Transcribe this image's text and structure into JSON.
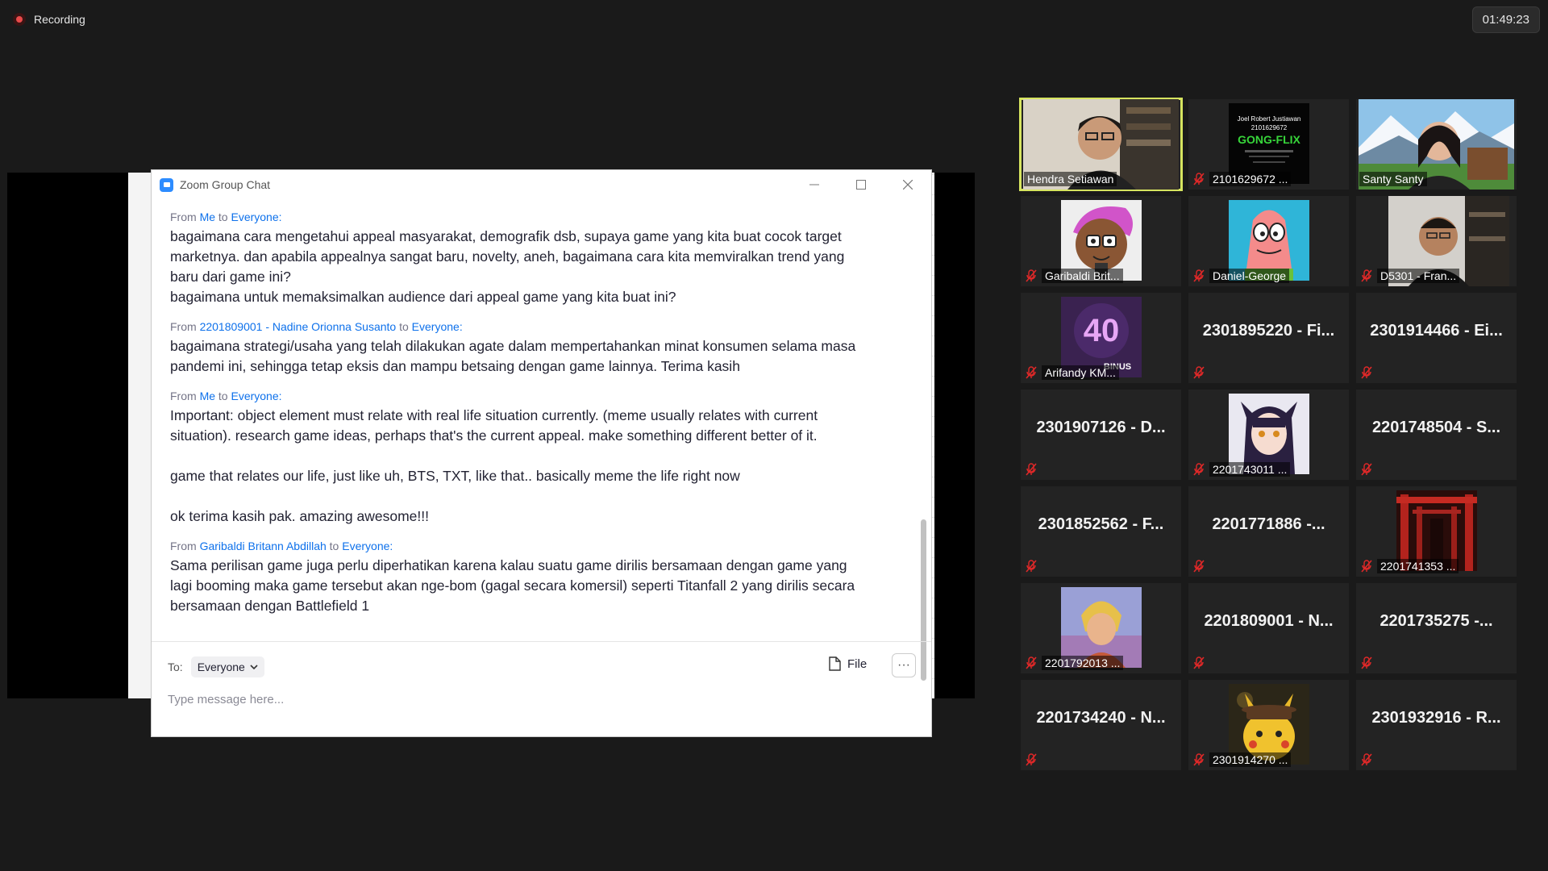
{
  "recording": {
    "label": "Recording"
  },
  "timer": "01:49:23",
  "chat": {
    "title": "Zoom Group Chat",
    "messages": [
      {
        "pre": "From ",
        "from": "Me",
        "mid": " to ",
        "to": "Everyone",
        "post": ":",
        "text": "bagaimana cara mengetahui appeal masyarakat, demografik dsb, supaya game yang kita buat cocok target\nmarketnya. dan apabila appealnya sangat baru, novelty, aneh, bagaimana cara kita memviralkan trend yang\nbaru dari game ini?\nbagaimana untuk memaksimalkan audience dari appeal game yang kita buat ini?"
      },
      {
        "pre": "From ",
        "from": "2201809001 - Nadine Orionna Susanto",
        "mid": " to ",
        "to": "Everyone",
        "post": ":",
        "text": "bagaimana strategi/usaha yang telah dilakukan agate dalam mempertahankan minat konsumen selama masa\npandemi ini, sehingga tetap eksis dan mampu betsaing dengan game lainnya. Terima kasih"
      },
      {
        "pre": "From ",
        "from": "Me",
        "mid": " to ",
        "to": "Everyone",
        "post": ":",
        "text": "Important: object element must relate with real life situation currently. (meme usually relates with current\nsituation). research game ideas, perhaps that's the current appeal. make something different better of it.\n\ngame that relates our life, just like uh, BTS, TXT, like that.. basically meme the life right now\n\nok terima kasih pak. amazing awesome!!!"
      },
      {
        "pre": "From ",
        "from": "Garibaldi Britann Abdillah",
        "mid": " to ",
        "to": "Everyone",
        "post": ":",
        "text": "Sama perilisan game juga perlu diperhatikan karena kalau suatu game dirilis bersamaan dengan game yang\nlagi booming maka game tersebut akan nge-bom (gagal secara komersil) seperti Titanfall 2 yang dirilis secara\nbersamaan dengan Battlefield 1"
      }
    ],
    "to_label": "To:",
    "to_value": "Everyone",
    "file_label": "File",
    "more_label": "···",
    "input_placeholder": "Type message here..."
  },
  "participants": [
    {
      "name": "Hendra Setiawan",
      "video": true,
      "muted": false,
      "active": true,
      "scene": "person-office"
    },
    {
      "name": "2101629672 ...",
      "video": true,
      "muted": true,
      "scene": "poster-gongflix",
      "poster_lines": [
        "Joel Robert Justiawan",
        "2101629672",
        "GONG-FLIX"
      ]
    },
    {
      "name": "Santy Santy",
      "video": true,
      "muted": false,
      "scene": "person-mountains"
    },
    {
      "name": "Garibaldi Brit...",
      "video": true,
      "muted": true,
      "scene": "cartoon-girl"
    },
    {
      "name": "Daniel-George",
      "video": true,
      "muted": true,
      "scene": "cartoon-star"
    },
    {
      "name": "D5301 - Fran...",
      "video": true,
      "muted": true,
      "scene": "person-dark"
    },
    {
      "name": "Arifandy KM...",
      "video": true,
      "muted": true,
      "scene": "binus-logo",
      "logo_text": "BINUS"
    },
    {
      "big": "2301895220 - Fi...",
      "muted": true
    },
    {
      "big": "2301914466 - Ei...",
      "muted": true
    },
    {
      "big": "2301907126 - D...",
      "muted": true
    },
    {
      "name": "2201743011 ...",
      "video": true,
      "muted": true,
      "scene": "anime-girl"
    },
    {
      "big": "2201748504 - S...",
      "muted": true
    },
    {
      "big": "2301852562 - F...",
      "muted": true
    },
    {
      "big": "2201771886 -...",
      "muted": true
    },
    {
      "name": "2201741353 ...",
      "video": true,
      "muted": true,
      "scene": "red-gates"
    },
    {
      "name": "2201792013 ...",
      "video": true,
      "muted": true,
      "scene": "anime-hero"
    },
    {
      "big": "2201809001 - N...",
      "muted": true
    },
    {
      "big": "2201735275 -...",
      "muted": true
    },
    {
      "big": "2201734240 - N...",
      "muted": true
    },
    {
      "name": "2301914270 ...",
      "video": true,
      "muted": true,
      "scene": "pikachu"
    },
    {
      "big": "2301932916 - R...",
      "muted": true
    }
  ],
  "colors": {
    "accent": "#0e71eb",
    "active_speaker": "#d6e45f",
    "mute": "#e02828"
  }
}
